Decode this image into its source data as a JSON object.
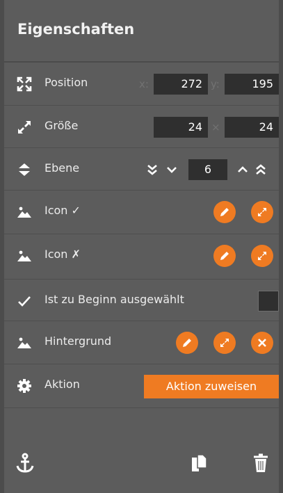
{
  "panel": {
    "title": "Eigenschaften"
  },
  "position": {
    "label": "Position",
    "x_prefix": "x:",
    "y_prefix": "y:",
    "x": "272",
    "y": "195"
  },
  "size": {
    "label": "Größe",
    "width": "24",
    "separator": "×",
    "height": "24"
  },
  "layer": {
    "label": "Ebene",
    "value": "6"
  },
  "icon_checked": {
    "label": "Icon ✓"
  },
  "icon_unchecked": {
    "label": "Icon ✗"
  },
  "initially_selected": {
    "label": "Ist zu Beginn ausgewählt",
    "checked": false
  },
  "background": {
    "label": "Hintergrund"
  },
  "action": {
    "label": "Aktion",
    "button_label": "Aktion zuweisen"
  },
  "footer": {
    "icons": [
      "anchor-icon",
      "duplicate-icon",
      "trash-icon"
    ]
  },
  "colors": {
    "accent": "#ef7b22",
    "panel_bg": "#5c5c5c",
    "field_bg": "#2f2f2f"
  }
}
